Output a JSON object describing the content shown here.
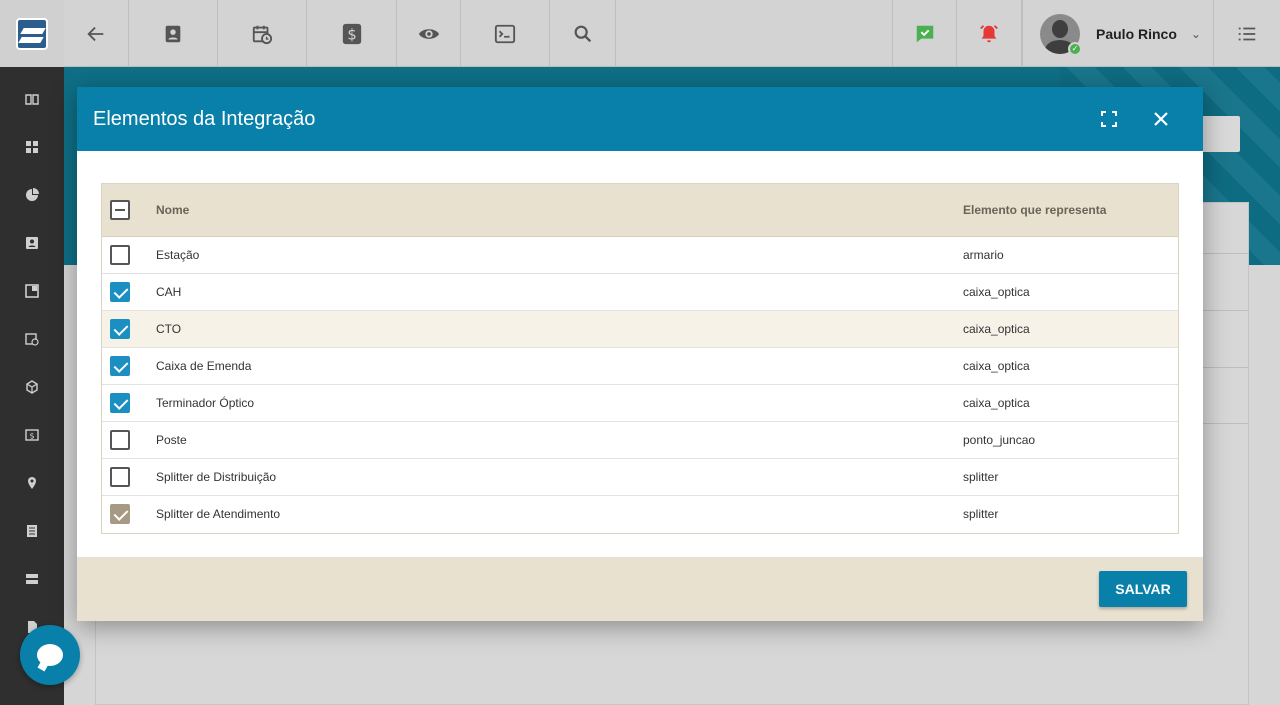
{
  "topbar": {
    "user_name": "Paulo Rinco"
  },
  "icons": {
    "back": "arrow-left-icon",
    "contacts": "contact-card-icon",
    "schedule": "calendar-clock-icon",
    "finance": "dollar-icon",
    "view": "eye-icon",
    "terminal": "terminal-icon",
    "search": "search-icon",
    "chat_ok": "chat-check-icon",
    "alarm": "alarm-bell-icon",
    "menu": "list-menu-icon"
  },
  "colors": {
    "accent": "#0880aa",
    "header_bg": "#e9e1d0",
    "checkbox_on": "#1b8fc2",
    "checkbox_disabled": "#a69a85",
    "chat_icon": "#4caf50",
    "alarm_icon": "#e53935"
  },
  "modal": {
    "title": "Elementos da Integração",
    "columns": {
      "name": "Nome",
      "element": "Elemento que representa"
    },
    "rows": [
      {
        "name": "Estação",
        "element": "armario",
        "state": "off"
      },
      {
        "name": "CAH",
        "element": "caixa_optica",
        "state": "on"
      },
      {
        "name": "CTO",
        "element": "caixa_optica",
        "state": "on"
      },
      {
        "name": "Caixa de Emenda",
        "element": "caixa_optica",
        "state": "on"
      },
      {
        "name": "Terminador Óptico",
        "element": "caixa_optica",
        "state": "on"
      },
      {
        "name": "Poste",
        "element": "ponto_juncao",
        "state": "off"
      },
      {
        "name": "Splitter de Distribuição",
        "element": "splitter",
        "state": "off"
      },
      {
        "name": "Splitter de Atendimento",
        "element": "splitter",
        "state": "disabled-on"
      }
    ],
    "save_label": "SALVAR"
  }
}
